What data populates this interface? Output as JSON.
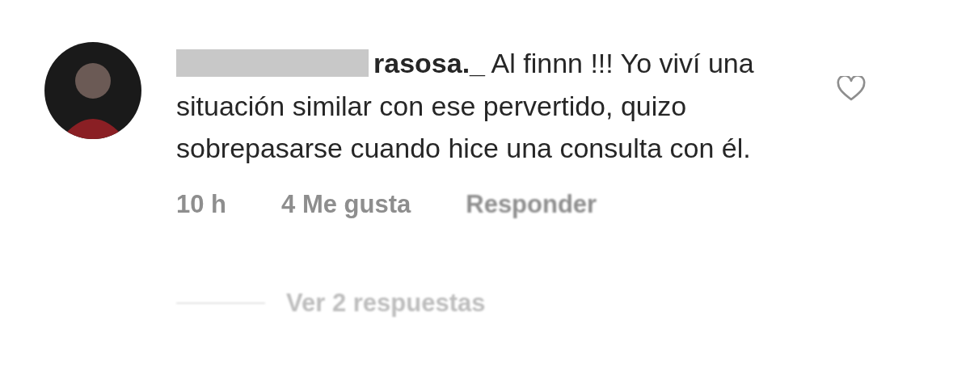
{
  "comment": {
    "username": "rasosa._",
    "text": "Al finnn !!! Yo viví una situación similar con ese pervertido, quizo sobrepasarse cuando hice una consulta con él.",
    "liked": false,
    "time": "10 h",
    "likes": "4 Me gusta",
    "reply": "Responder"
  },
  "replies": {
    "label": "Ver 2 respuestas"
  }
}
